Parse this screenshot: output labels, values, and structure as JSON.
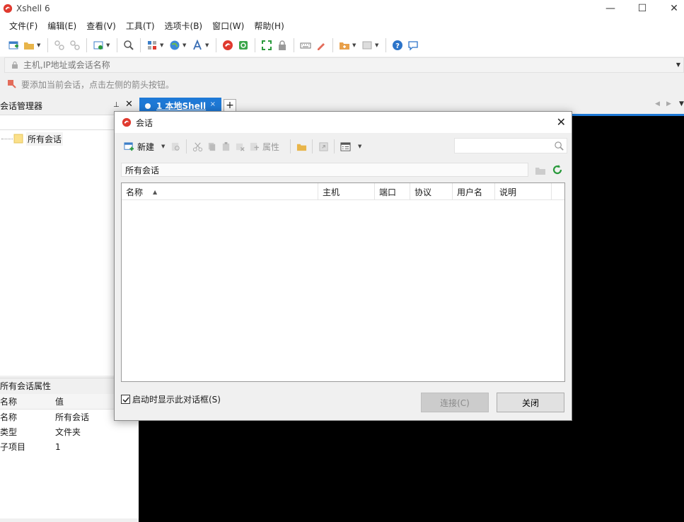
{
  "window": {
    "title": "Xshell 6",
    "minimize": "—",
    "maximize": "☐",
    "close": "✕"
  },
  "menubar": {
    "items": [
      "文件(F)",
      "编辑(E)",
      "查看(V)",
      "工具(T)",
      "选项卡(B)",
      "窗口(W)",
      "帮助(H)"
    ]
  },
  "addressbar": {
    "placeholder": "主机,IP地址或会话名称"
  },
  "hint": {
    "text": "要添加当前会话，点击左侧的箭头按钮。"
  },
  "session_manager": {
    "title": "会话管理器",
    "pin": "⊥",
    "close": "✕",
    "tree": [
      {
        "label": "所有会话"
      }
    ]
  },
  "properties": {
    "title": "所有会话属性",
    "col_name": "名称",
    "col_value": "值",
    "rows": [
      {
        "name": "名称",
        "value": "所有会话"
      },
      {
        "name": "类型",
        "value": "文件夹"
      },
      {
        "name": "子项目",
        "value": "1"
      }
    ]
  },
  "tabs": {
    "active_label": "1 本地Shell",
    "close": "×",
    "add": "+"
  },
  "dialog": {
    "title": "会话",
    "close": "✕",
    "toolbar": {
      "new_label": "新建",
      "properties_label": "属性"
    },
    "path": "所有会话",
    "columns": [
      "名称",
      "主机",
      "端口",
      "协议",
      "用户名",
      "说明"
    ],
    "sort_arrow": "▲",
    "checkbox_label": "启动时显示此对话框(S)",
    "checkbox_checked": true,
    "connect_label": "连接(C)",
    "close_label": "关闭"
  },
  "colors": {
    "accent": "#1e79d6",
    "terminal_bg": "#000000"
  }
}
